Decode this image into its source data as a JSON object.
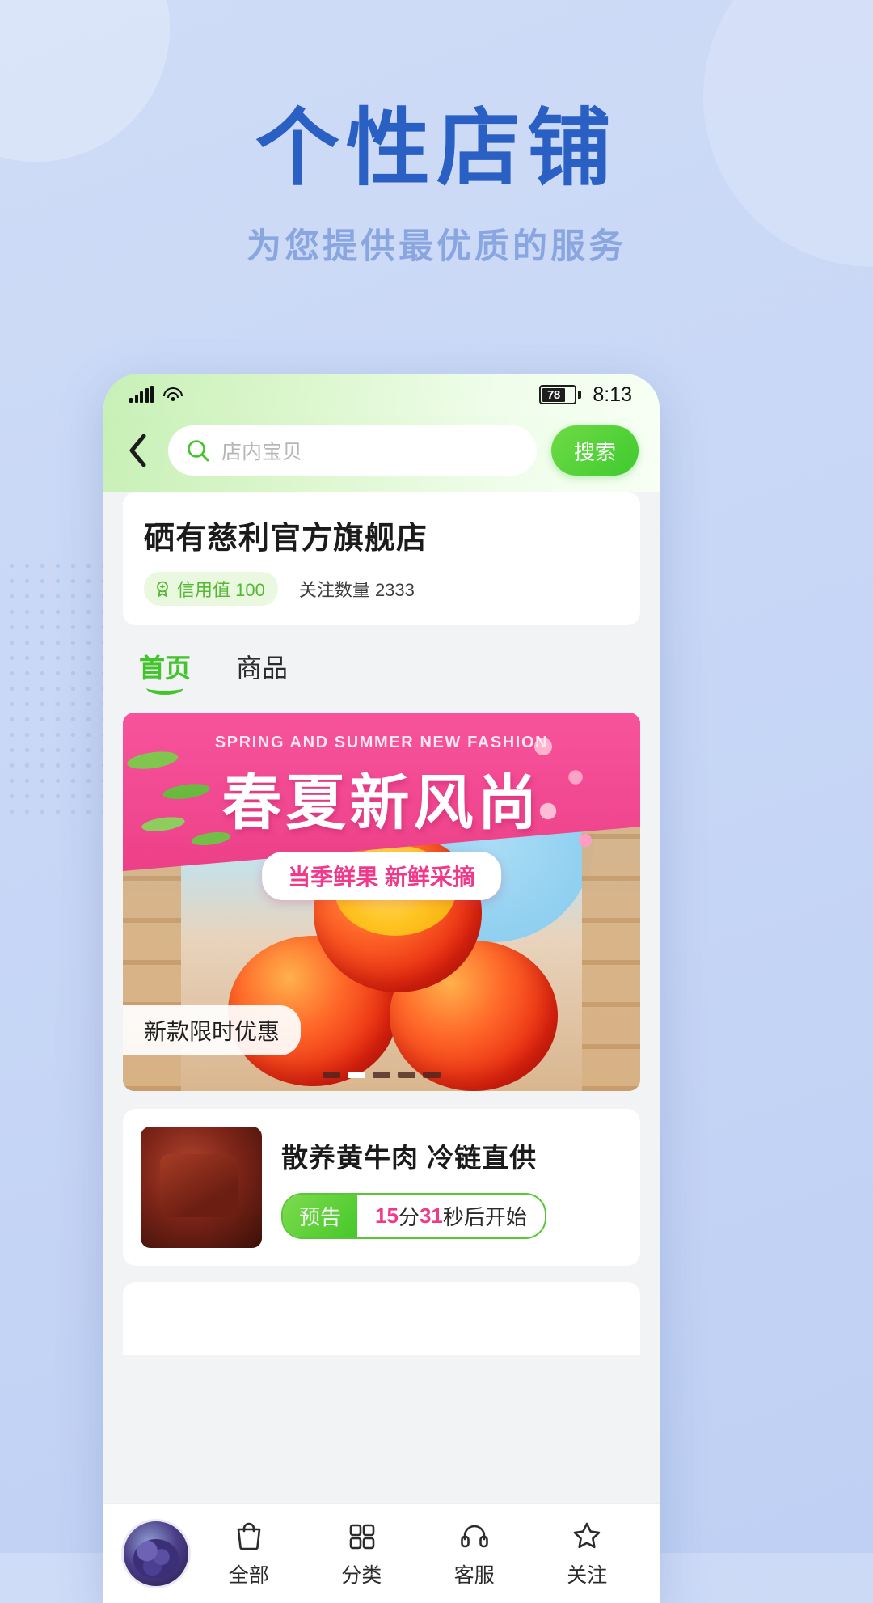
{
  "hero": {
    "title": "个性店铺",
    "subtitle": "为您提供最优质的服务",
    "title_color": "#2a5fc4",
    "subtitle_color": "#8aa6e0"
  },
  "statusbar": {
    "signal_icon": "signal-bars-icon",
    "wifi_icon": "wifi-icon",
    "battery_level": "78",
    "time": "8:13"
  },
  "header": {
    "back_icon": "chevron-left-icon",
    "search_icon": "search-icon",
    "search_placeholder": "店内宝贝",
    "search_value": "",
    "search_button": "搜索",
    "accent_color": "#43c32c"
  },
  "store": {
    "name": "硒有慈利官方旗舰店",
    "credit_icon": "medal-icon",
    "credit_label": "信用值 100",
    "follow_label": "关注数量  2333"
  },
  "tabs": [
    {
      "label": "首页",
      "active": true
    },
    {
      "label": "商品",
      "active": false
    }
  ],
  "banner": {
    "english_title": "SPRING AND SUMMER NEW FASHION",
    "chinese_title": "春夏新风尚",
    "pill_text": "当季鲜果  新鲜采摘",
    "corner_tag": "新款限时优惠",
    "dots_total": 5,
    "dots_active_index": 1,
    "pink_color": "#f0398a"
  },
  "product": {
    "thumb_icon": "beef-thumbnail",
    "title": "散养黄牛肉 冷链直供",
    "live_tag": "预告",
    "countdown_prefix": "",
    "countdown_minutes": "15",
    "countdown_unit_min": "分",
    "countdown_seconds": "31",
    "countdown_unit_sec": "秒后开始"
  },
  "bottom_nav": {
    "logo_icon": "store-avatar-icon",
    "items": [
      {
        "icon": "bag-icon",
        "label": "全部"
      },
      {
        "icon": "grid-icon",
        "label": "分类"
      },
      {
        "icon": "headset-icon",
        "label": "客服"
      },
      {
        "icon": "star-icon",
        "label": "关注"
      }
    ]
  }
}
